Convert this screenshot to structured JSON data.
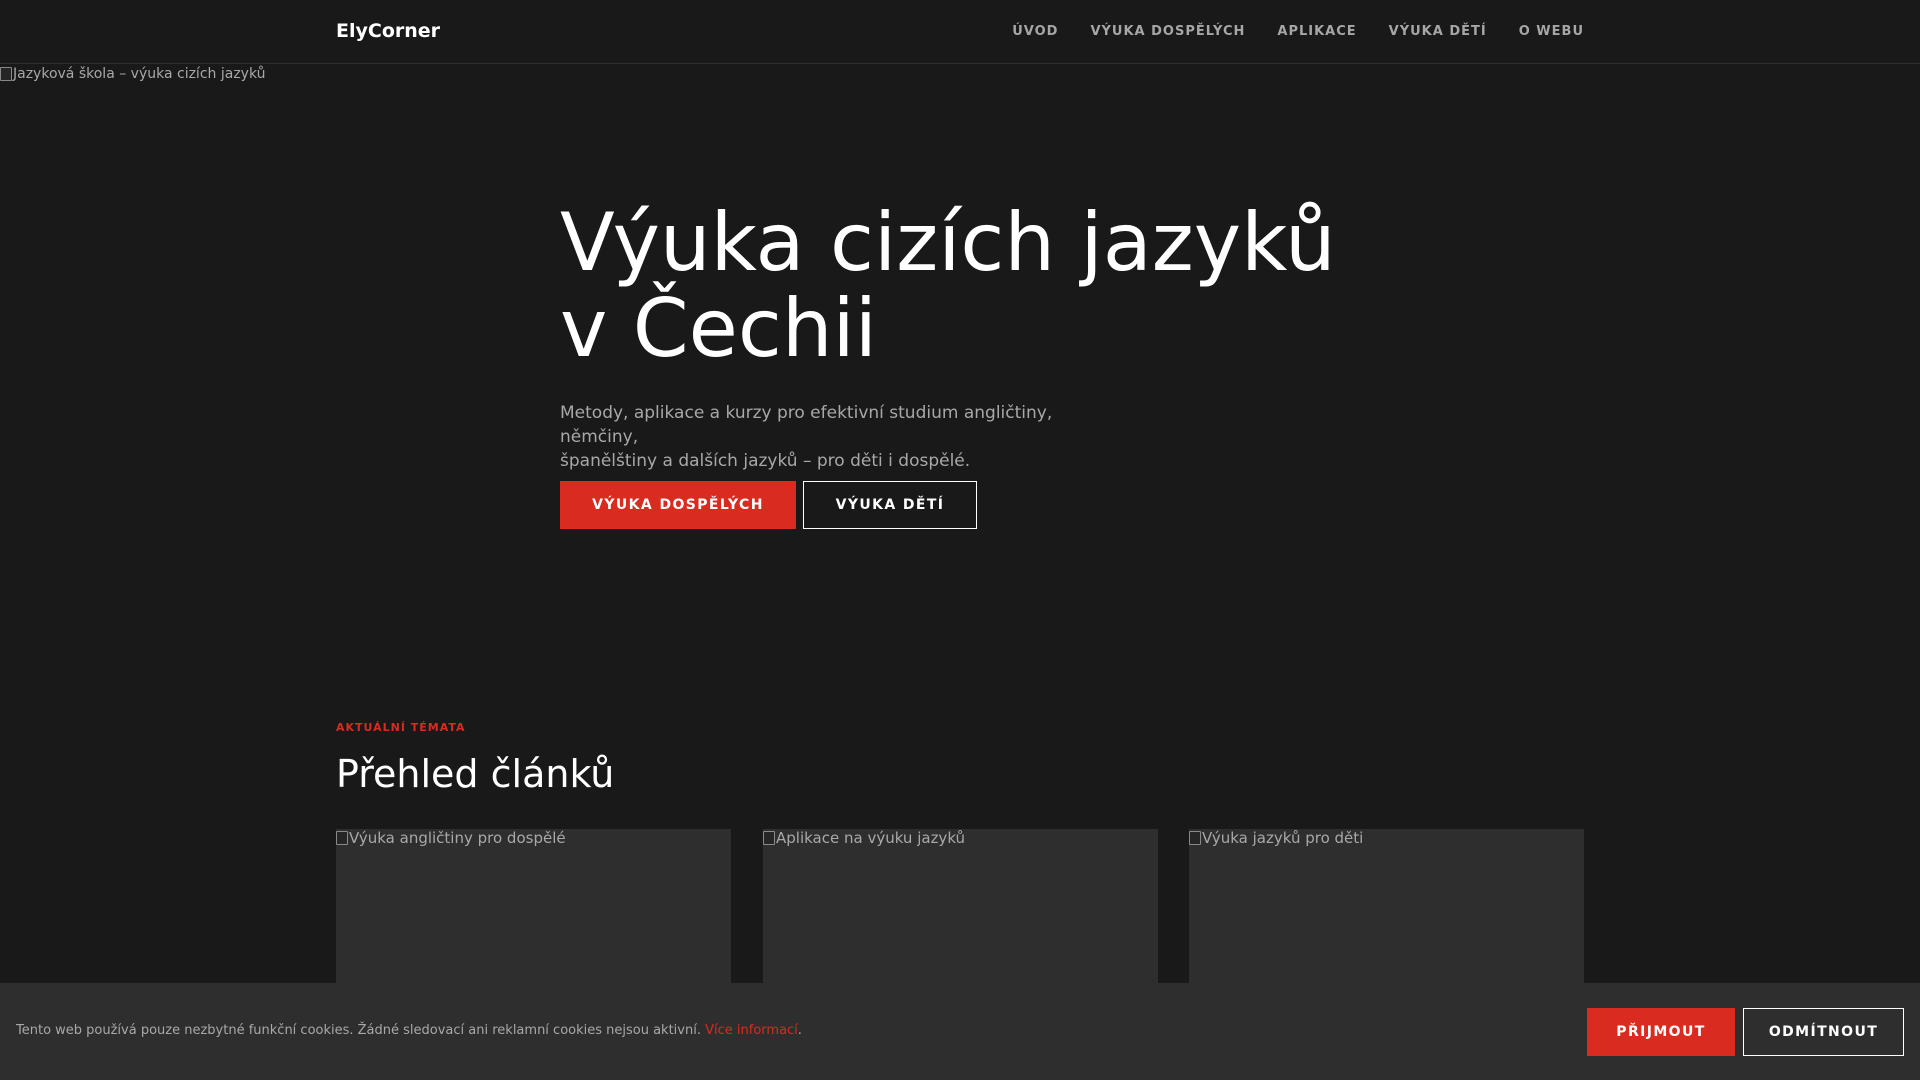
{
  "header": {
    "brand": "ElyCorner",
    "nav": [
      {
        "label": "ÚVOD"
      },
      {
        "label": "VÝUKA DOSPĚLÝCH"
      },
      {
        "label": "APLIKACE"
      },
      {
        "label": "VÝUKA DĚTÍ"
      },
      {
        "label": "O WEBU"
      }
    ]
  },
  "hero": {
    "image_alt": "Jazyková škola – výuka cizích jazyků",
    "title_line1": "Výuka cizích jazyků",
    "title_line2": "v Čechii",
    "subtitle_line1": "Metody, aplikace a kurzy pro efektivní studium angličtiny, němčiny,",
    "subtitle_line2": "španělštiny a dalších jazyků – pro děti i dospělé.",
    "primary_button": "VÝUKA DOSPĚLÝCH",
    "secondary_button": "VÝUKA DĚTÍ"
  },
  "articles": {
    "eyebrow": "AKTUÁLNÍ TÉMATA",
    "title": "Přehled článků",
    "cards": [
      {
        "image_alt": "Výuka angličtiny pro dospělé"
      },
      {
        "image_alt": "Aplikace na výuku jazyků"
      },
      {
        "image_alt": "Výuka jazyků pro děti"
      }
    ]
  },
  "cookie": {
    "text": "Tento web používá pouze nezbytné funkční cookies. Žádné sledovací ani reklamní cookies nejsou aktivní.",
    "link": "Více informací",
    "link_suffix": ".",
    "accept": "PŘIJMOUT",
    "decline": "ODMÍTNOUT"
  },
  "colors": {
    "background": "#191919",
    "accent": "#d92b20",
    "card": "#2e2e2e",
    "muted_text": "#a8a8a8"
  }
}
